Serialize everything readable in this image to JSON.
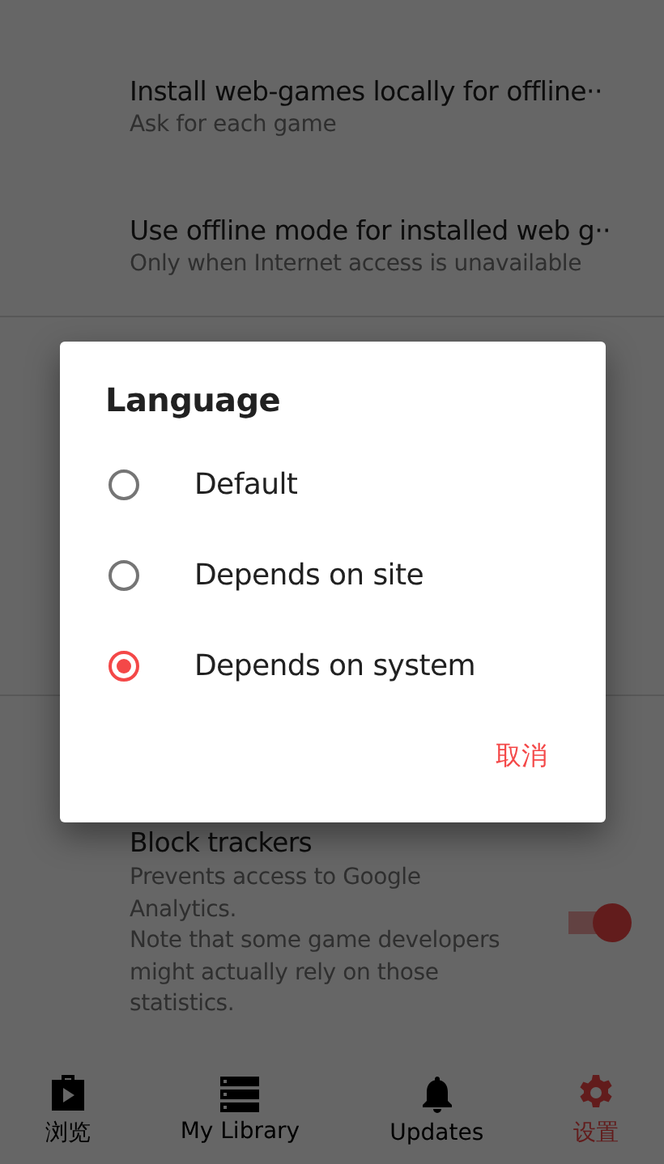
{
  "settings": [
    {
      "title": "Install web-games locally for offline··",
      "summary": "Ask for each game"
    },
    {
      "title": "Use offline mode for installed web g··",
      "summary": "Only when Internet access is unavailable"
    }
  ],
  "block_trackers": {
    "title": "Block trackers",
    "summary": "Prevents access to Google Analytics.\nNote that some game developers might actually rely on those statistics.",
    "on": true
  },
  "dialog": {
    "title": "Language",
    "options": [
      {
        "label": "Default",
        "selected": false
      },
      {
        "label": "Depends on site",
        "selected": false
      },
      {
        "label": "Depends on system",
        "selected": true
      }
    ],
    "cancel": "取消"
  },
  "nav": [
    {
      "label": "浏览",
      "kind": "browse",
      "selected": false
    },
    {
      "label": "My Library",
      "kind": "library",
      "selected": false
    },
    {
      "label": "Updates",
      "kind": "updates",
      "selected": false
    },
    {
      "label": "设置",
      "kind": "settings",
      "selected": true
    }
  ]
}
